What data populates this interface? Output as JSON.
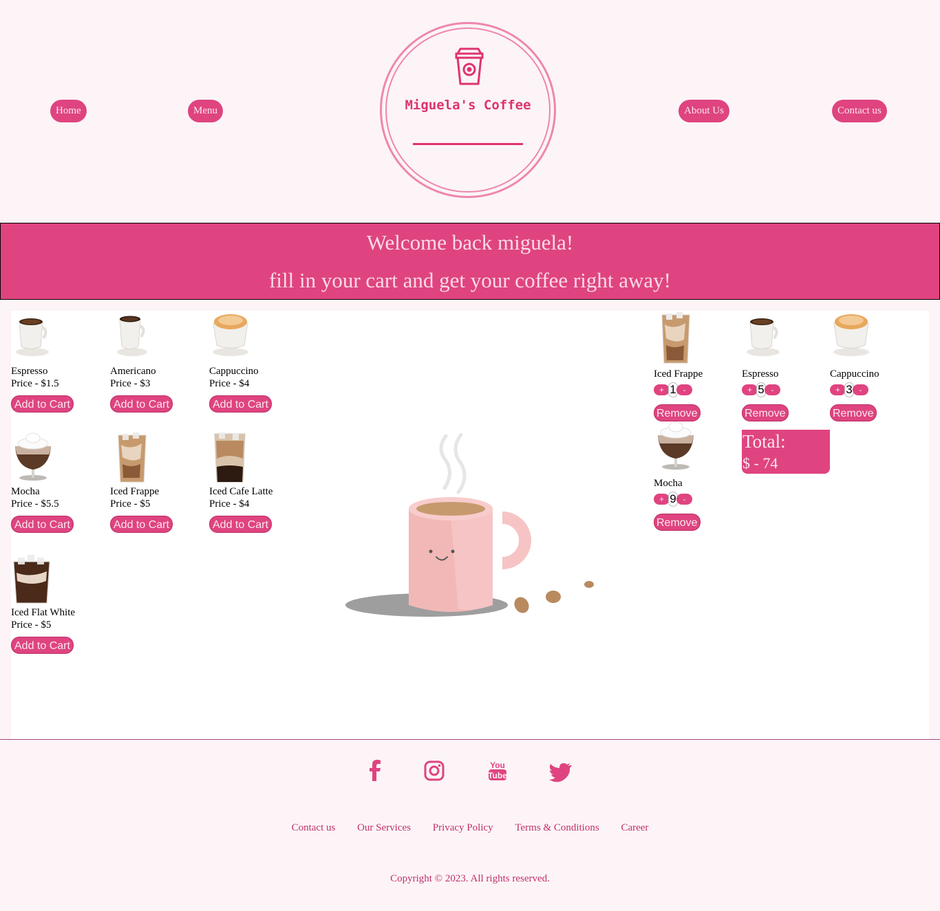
{
  "nav": {
    "home": "Home",
    "menu": "Menu",
    "about": "About Us",
    "contact": "Contact us"
  },
  "logo": {
    "title": "Miguela's Coffee"
  },
  "banner": {
    "line1": "Welcome back miguela!",
    "line2": "fill in your cart and get your coffee right away!"
  },
  "products": [
    {
      "name": "Espresso",
      "price": "Price - $1.5",
      "button": "Add to Cart",
      "icon": "espresso-cup-icon"
    },
    {
      "name": "Americano",
      "price": "Price - $3",
      "button": "Add to Cart",
      "icon": "americano-cup-icon"
    },
    {
      "name": "Cappuccino",
      "price": "Price - $4",
      "button": "Add to Cart",
      "icon": "cappuccino-cup-icon"
    },
    {
      "name": "Mocha",
      "price": "Price - $5.5",
      "button": "Add to Cart",
      "icon": "mocha-glass-icon"
    },
    {
      "name": "Iced Frappe",
      "price": "Price - $5",
      "button": "Add to Cart",
      "icon": "iced-frappe-glass-icon"
    },
    {
      "name": "Iced Cafe Latte",
      "price": "Price - $4",
      "button": "Add to Cart",
      "icon": "iced-latte-glass-icon"
    },
    {
      "name": "Iced Flat White",
      "price": "Price - $5",
      "button": "Add to Cart",
      "icon": "iced-flat-white-glass-icon"
    }
  ],
  "cart": {
    "items": [
      {
        "name": "Iced Frappe",
        "qty": "1",
        "plus": "+",
        "minus": "-",
        "remove": "Remove"
      },
      {
        "name": "Espresso",
        "qty": "5",
        "plus": "+",
        "minus": "-",
        "remove": "Remove"
      },
      {
        "name": "Cappuccino",
        "qty": "3",
        "plus": "+",
        "minus": "-",
        "remove": "Remove"
      },
      {
        "name": "Mocha",
        "qty": "9",
        "plus": "+",
        "minus": "-",
        "remove": "Remove"
      }
    ],
    "total_label": "Total:",
    "total_value": "$ - 74"
  },
  "footer": {
    "social": [
      "facebook-icon",
      "instagram-icon",
      "youtube-icon",
      "twitter-icon"
    ],
    "links": [
      "Contact us",
      "Our Services",
      "Privacy Policy",
      "Terms & Conditions",
      "Career"
    ],
    "copyright": "Copyright © 2023. All rights reserved."
  },
  "colors": {
    "accent": "#df4480",
    "background": "#fcf4f7",
    "logo_ring": "#ee86ad",
    "link": "#c2306c"
  }
}
